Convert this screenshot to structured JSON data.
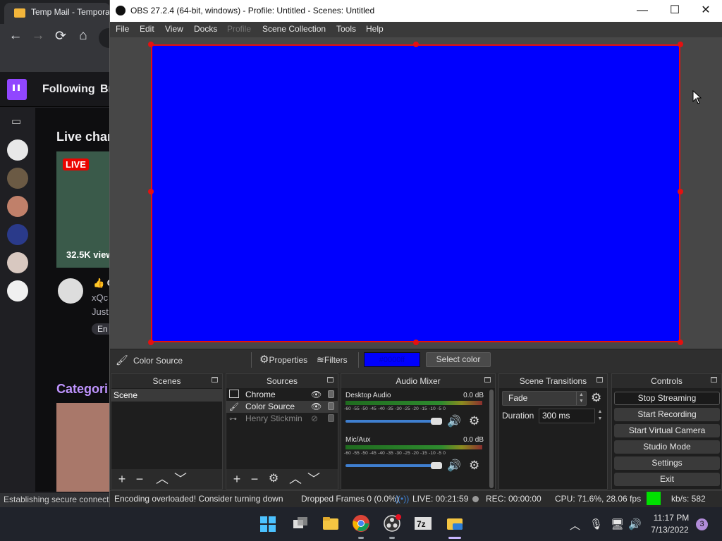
{
  "browser": {
    "tab_title": "Temp Mail - Tempora",
    "status_text": "Establishing secure connecti",
    "twitch": {
      "nav_following": "Following",
      "nav_browse": "Br",
      "live_heading": "Live chan",
      "live_badge": "LIVE",
      "viewers": "32.5K view",
      "channel_line1": "👍 C",
      "channel_line2": "xQc",
      "channel_line3": "Just",
      "channel_tag": "En",
      "categories_heading": "Categori"
    }
  },
  "obs": {
    "window_title": "OBS 27.2.4 (64-bit, windows) - Profile: Untitled - Scenes: Untitled",
    "menu": [
      "File",
      "Edit",
      "View",
      "Docks",
      "Profile",
      "Scene Collection",
      "Tools",
      "Help"
    ],
    "source_toolbar": {
      "selected_source": "Color Source",
      "properties": "Properties",
      "filters": "Filters",
      "color_hex": "#0000ff",
      "select_color": "Select color"
    },
    "scenes": {
      "title": "Scenes",
      "items": [
        "Scene"
      ]
    },
    "sources": {
      "title": "Sources",
      "items": [
        {
          "name": "Chrome",
          "visible": true
        },
        {
          "name": "Color Source",
          "visible": true
        },
        {
          "name": "Henry Stickmin",
          "visible": false
        }
      ]
    },
    "mixer": {
      "title": "Audio Mixer",
      "channels": [
        {
          "name": "Desktop Audio",
          "db": "0.0 dB",
          "volume": 0.95
        },
        {
          "name": "Mic/Aux",
          "db": "0.0 dB",
          "volume": 0.95
        }
      ],
      "scale": "-60 -55 -50 -45 -40 -35 -30 -25 -20 -15 -10 -5 0"
    },
    "transitions": {
      "title": "Scene Transitions",
      "selected": "Fade",
      "duration_label": "Duration",
      "duration_value": "300 ms"
    },
    "controls": {
      "title": "Controls",
      "buttons": [
        "Stop Streaming",
        "Start Recording",
        "Start Virtual Camera",
        "Studio Mode",
        "Settings",
        "Exit"
      ]
    },
    "status": {
      "encoding": "Encoding overloaded! Consider turning down",
      "dropped": "Dropped Frames 0 (0.0%)",
      "live": "LIVE: 00:21:59",
      "rec": "REC: 00:00:00",
      "cpu": "CPU: 71.6%, 28.06 fps",
      "kbs": "kb/s: 582"
    },
    "colors": {
      "preview_fill": "#0000fe",
      "selection": "#e51010",
      "status_ok": "#00e000"
    }
  },
  "taskbar": {
    "time": "11:17 PM",
    "date": "7/13/2022",
    "notifications": "3"
  }
}
